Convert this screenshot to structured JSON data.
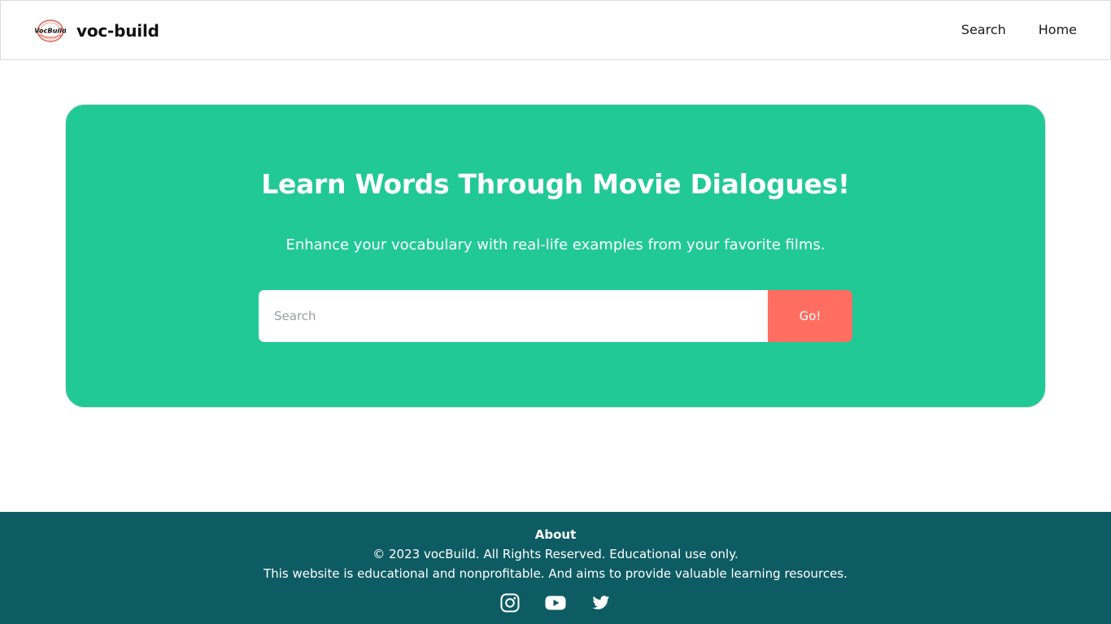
{
  "header": {
    "logo_text": "VocBuild",
    "brand": "voc-build",
    "nav": [
      {
        "label": "Search"
      },
      {
        "label": "Home"
      }
    ]
  },
  "hero": {
    "title": "Learn Words Through Movie Dialogues!",
    "subtitle": "Enhance your vocabulary with real-life examples from your favorite films.",
    "search": {
      "placeholder": "Search",
      "value": "",
      "button_label": "Go!"
    }
  },
  "footer": {
    "heading": "About",
    "copyright": "© 2023 vocBuild. All Rights Reserved. Educational use only.",
    "description": "This website is educational and nonprofitable. And aims to provide valuable learning resources.",
    "social": [
      "instagram-icon",
      "youtube-icon",
      "twitter-icon"
    ]
  },
  "colors": {
    "hero_bg": "#21c996",
    "button_bg": "#ff6e61",
    "footer_bg": "#0e5c63"
  }
}
